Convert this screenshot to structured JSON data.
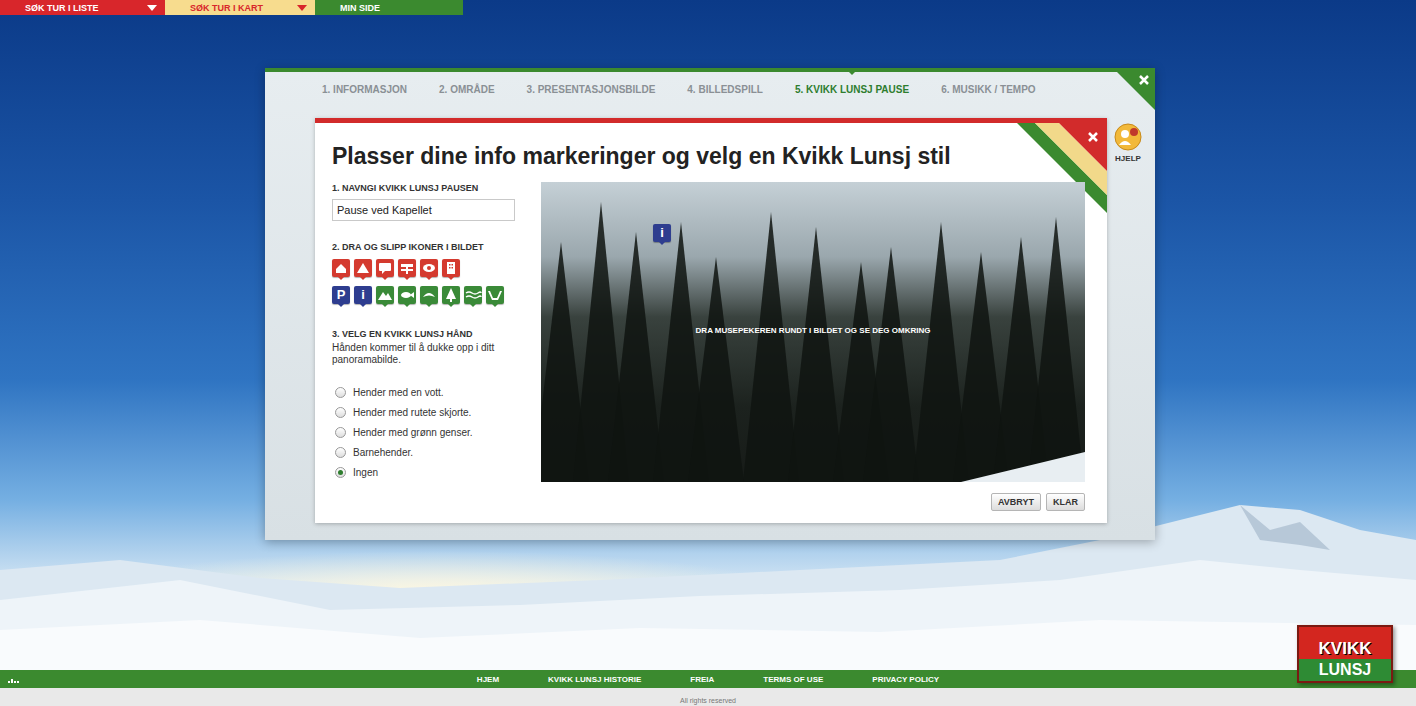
{
  "nav": [
    {
      "label": "SØK TUR I LISTE",
      "color": "#d8262b"
    },
    {
      "label": "SØK TUR I KART",
      "color": "#f7dc8e"
    },
    {
      "label": "MIN SIDE",
      "color": "#3b8a2f"
    }
  ],
  "dialog": {
    "steps": [
      {
        "label": "1. INFORMASJON",
        "selected": false
      },
      {
        "label": "2. OMRÅDE",
        "selected": false
      },
      {
        "label": "3. PRESENTASJONSBILDE",
        "selected": false
      },
      {
        "label": "4. BILLEDSPILL",
        "selected": false
      },
      {
        "label": "5. KVIKK LUNSJ PAUSE",
        "selected": true
      },
      {
        "label": "6. MUSIKK / TEMPO",
        "selected": false
      }
    ],
    "help": "HJELP",
    "panel": {
      "title": "Plasser dine info markeringer og velg en Kvikk Lunsj stil",
      "name_label": "1. NAVNGI KVIKK LUNSJ PAUSEN",
      "name_value": "Pause ved Kapellet",
      "icons_label": "2. DRA OG SLIPP IKONER I BILDET",
      "icon_rows": [
        [
          {
            "kind": "house",
            "color": "#d43a2f"
          },
          {
            "kind": "peak",
            "color": "#d43a2f"
          },
          {
            "kind": "bubble",
            "color": "#d43a2f"
          },
          {
            "kind": "sign",
            "color": "#d43a2f"
          },
          {
            "kind": "eye",
            "color": "#d43a2f"
          },
          {
            "kind": "building",
            "color": "#d43a2f"
          }
        ],
        [
          {
            "kind": "letter",
            "glyph": "P",
            "color": "#2e3d8f"
          },
          {
            "kind": "letter",
            "glyph": "i",
            "color": "#2e3d8f"
          },
          {
            "kind": "mountains",
            "color": "#3a8a38"
          },
          {
            "kind": "fish",
            "color": "#3a8a38"
          },
          {
            "kind": "bird",
            "color": "#3a8a38"
          },
          {
            "kind": "tree",
            "color": "#3a8a38"
          },
          {
            "kind": "waves",
            "color": "#3a8a38"
          },
          {
            "kind": "valley",
            "color": "#3a8a38"
          }
        ]
      ],
      "hand_label": "3. VELG EN KVIKK LUNSJ HÅND",
      "hand_desc": "Hånden kommer til å dukke opp i ditt panoramabilde.",
      "hands": [
        {
          "label": "Hender med en vott.",
          "selected": false
        },
        {
          "label": "Hender med rutete skjorte.",
          "selected": false
        },
        {
          "label": "Hender med grønn genser.",
          "selected": false
        },
        {
          "label": "Barnehender.",
          "selected": false
        },
        {
          "label": "Ingen",
          "selected": true
        }
      ],
      "photo": {
        "hint": "DRA MUSEPEKEREN RUNDT I BILDET OG SE DEG OMKRING",
        "markers": [
          {
            "kind": "letter",
            "glyph": "i",
            "color": "#2e3d8f"
          }
        ]
      },
      "buttons": [
        "AVBRYT",
        "KLAR"
      ]
    }
  },
  "footer": {
    "links": [
      "HJEM",
      "KVIKK LUNSJ HISTORIE",
      "FREIA",
      "TERMS OF USE",
      "PRIVACY POLICY"
    ],
    "copyright": "All rights reserved"
  },
  "logo": {
    "top": "KVIKK",
    "bottom": "LUNSJ"
  }
}
